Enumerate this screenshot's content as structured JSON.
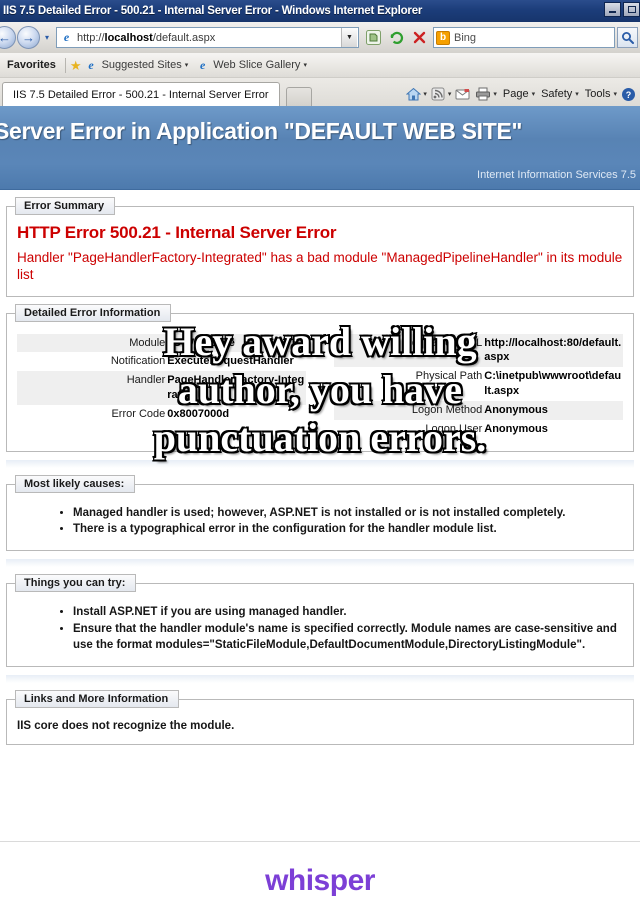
{
  "window": {
    "title": "IIS 7.5 Detailed Error - 500.21 - Internal Server Error - Windows Internet Explorer",
    "minimize_label": "Minimize",
    "maximize_label": "Maximize"
  },
  "toolbar": {
    "back_icon": "back-arrow-icon",
    "forward_icon": "forward-arrow-icon",
    "history_caret": "▾",
    "url": "http://localhost/default.aspx",
    "url_host": "localhost",
    "url_prefix": "http://",
    "url_path": "/default.aspx",
    "url_dropdown_caret": "▼",
    "compat_button": "Compatibility View",
    "refresh_button": "Refresh",
    "stop_button": "Stop",
    "search_engine": "Bing",
    "search_value": "Bing",
    "search_placeholder": "Bing",
    "search_go": "Search"
  },
  "favorites_bar": {
    "label": "Favorites",
    "items": [
      {
        "label": "Suggested Sites",
        "icon": "ie-logo-icon",
        "caret": "▾"
      },
      {
        "label": "Web Slice Gallery",
        "icon": "ie-logo-icon",
        "caret": "▾"
      }
    ]
  },
  "tabs": {
    "active": "IIS 7.5 Detailed Error - 500.21 - Internal Server Error",
    "new_tab_label": "New Tab"
  },
  "command_bar": {
    "home_icon": "home-icon",
    "feeds_icon": "rss-feed-icon",
    "mail_icon": "mail-icon",
    "print_icon": "printer-icon",
    "caret": "▾",
    "menus": [
      "Page",
      "Safety",
      "Tools"
    ],
    "help_icon": "help-icon"
  },
  "page": {
    "banner_title": "Server Error in Application \"DEFAULT WEB SITE\"",
    "banner_subtitle": "Internet Information Services 7.5",
    "error_summary": {
      "legend": "Error Summary",
      "heading": "HTTP Error 500.21 - Internal Server Error",
      "detail": "Handler \"PageHandlerFactory-Integrated\" has a bad module \"ManagedPipelineHandler\" in its module list"
    },
    "detailed_error": {
      "legend": "Detailed Error Information",
      "left_rows": [
        {
          "label": "Module",
          "value": "IIS Web Core"
        },
        {
          "label": "Notification",
          "value": "ExecuteRequestHandler"
        },
        {
          "label": "Handler",
          "value": "PageHandlerFactory-Integrated"
        },
        {
          "label": "Error Code",
          "value": "0x8007000d"
        }
      ],
      "right_rows": [
        {
          "label": "Requested URL",
          "value": "http://localhost:80/default.aspx"
        },
        {
          "label": "Physical Path",
          "value": "C:\\inetpub\\wwwroot\\default.aspx"
        },
        {
          "label": "Logon Method",
          "value": "Anonymous"
        },
        {
          "label": "Logon User",
          "value": "Anonymous"
        }
      ]
    },
    "most_likely_causes": {
      "legend": "Most likely causes:",
      "items": [
        "Managed handler is used; however, ASP.NET is not installed or is not installed completely.",
        "There is a typographical error in the configuration for the handler module list."
      ]
    },
    "things_you_can_try": {
      "legend": "Things you can try:",
      "items": [
        "Install ASP.NET if you are using managed handler.",
        "Ensure that the handler module's name is specified correctly. Module names are case-sensitive and use the format modules=\"StaticFileModule,DefaultDocumentModule,DirectoryListingModule\"."
      ]
    },
    "links_and_more": {
      "legend": "Links and More Information",
      "text": "IIS core does not recognize the module."
    }
  },
  "overlay": {
    "line1": "Hey award willing",
    "line2": "author, you have",
    "line3": "punctuation errors."
  },
  "footer": {
    "brand": "whisper",
    "brand_color": "#7c3fd6"
  }
}
